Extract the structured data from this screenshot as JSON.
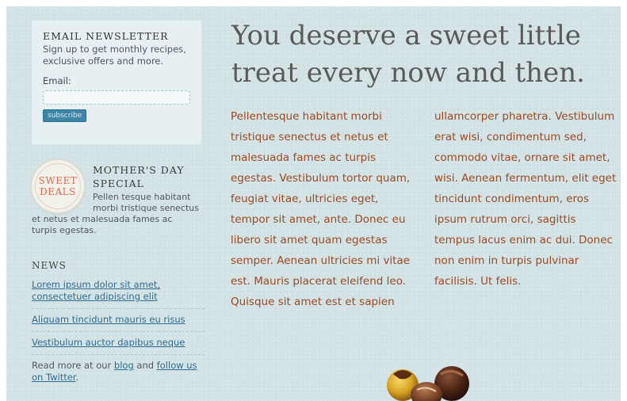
{
  "newsletter": {
    "title": "EMAIL NEWSLETTER",
    "description": "Sign up to get monthly recipes, exclusive offers and more.",
    "email_label": "Email:",
    "email_value": "",
    "email_placeholder": "",
    "subscribe_label": "subscribe"
  },
  "promo": {
    "seal_line1": "SWEET",
    "seal_line2": "DEALS",
    "title_line1": "MOTHER'S DAY",
    "title_line2": "SPECIAL",
    "text_line1": "Pellen tesque habitant",
    "text_line2": "morbi tristique senectus",
    "text_line3": "et netus et malesuada fames ac",
    "text_line4": "turpis egestas."
  },
  "news": {
    "title": "NEWS",
    "items": [
      {
        "label": "Lorem ipsum dolor sit amet, consectetuer adipiscing elit"
      },
      {
        "label": "Aliquam tincidunt mauris eu risus"
      },
      {
        "label": "Vestibulum auctor dapibus neque"
      }
    ],
    "more_prefix": "Read more at our",
    "blog_link": "blog",
    "and": "and",
    "twitter_link": "follow us on Twitter",
    "period": "."
  },
  "main": {
    "headline_line1": "You deserve a sweet little",
    "headline_line2": "treat every now and then.",
    "column_left": "Pellentesque habitant morbi tristique senectus et netus et malesuada fames ac turpis egestas. Vestibulum tortor quam, feugiat vitae, ultricies eget, tempor sit amet, ante. Donec eu libero sit amet quam egestas semper. Aenean ultricies mi vitae est. Mauris placerat eleifend leo. Quisque sit amet est et sapien",
    "column_right": "ullamcorper pharetra. Vestibulum erat wisi, condimentum sed, commodo vitae, ornare sit amet, wisi. Aenean fermentum, elit eget tincidunt condimentum, eros ipsum rutrum orci, sagittis tempus lacus enim ac dui. Donec non enim in turpis pulvinar facilisis. Ut felis."
  },
  "colors": {
    "background": "#d3e3e5",
    "body_text": "#9a4a23",
    "link": "#2f6c93",
    "button": "#3d86a6",
    "seal_text": "#e0684f"
  }
}
